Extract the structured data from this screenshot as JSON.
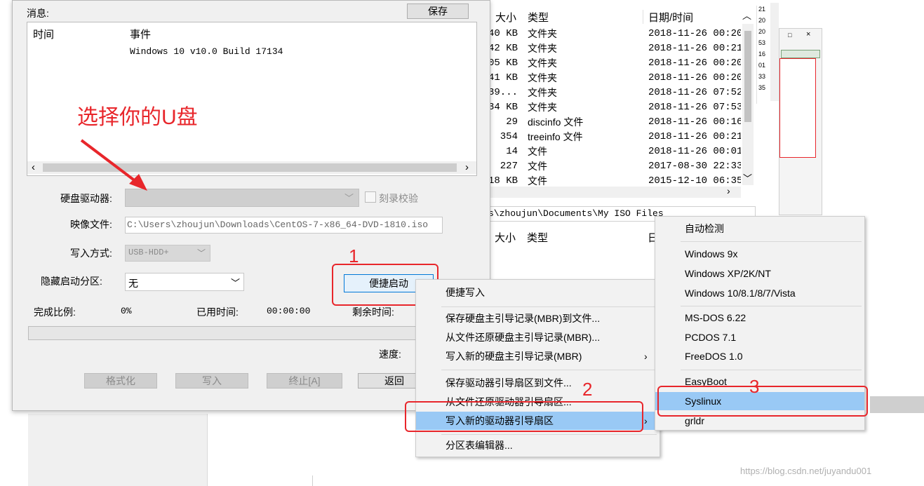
{
  "message_panel": {
    "title": "消息:",
    "save_button": "保存",
    "columns": [
      "时间",
      "事件"
    ],
    "rows": [
      {
        "time": "",
        "event": "Windows 10 v10.0 Build 17134"
      }
    ]
  },
  "annotation": {
    "text": "选择你的U盘",
    "n1": "1",
    "n2": "2",
    "n3": "3"
  },
  "form": {
    "drive_label": "硬盘驱动器:",
    "drive_value": "",
    "verify_label": "刻录校验",
    "image_label": "映像文件:",
    "image_value": "C:\\Users\\zhoujun\\Downloads\\CentOS-7-x86_64-DVD-1810.iso",
    "write_mode_label": "写入方式:",
    "write_mode_value": "USB-HDD+",
    "hide_label": "隐藏启动分区:",
    "hide_value": "无",
    "quick_boot_button": "便捷启动"
  },
  "progress": {
    "ratio_label": "完成比例:",
    "ratio_value": "0%",
    "elapsed_label": "已用时间:",
    "elapsed_value": "00:00:00",
    "remaining_label": "剩余时间:",
    "speed_label": "速度:",
    "fill": 0
  },
  "buttons": {
    "format": "格式化",
    "write": "写入",
    "stop": "终止[A]",
    "back": "返回"
  },
  "file_list_top": {
    "columns": [
      "大小",
      "类型",
      "日期/时间"
    ],
    "rows": [
      {
        "size": "40 KB",
        "type": "文件夹",
        "date": "2018-11-26 00:20"
      },
      {
        "size": "42 KB",
        "type": "文件夹",
        "date": "2018-11-26 00:21"
      },
      {
        "size": "05 KB",
        "type": "文件夹",
        "date": "2018-11-26 00:20"
      },
      {
        "size": "41 KB",
        "type": "文件夹",
        "date": "2018-11-26 00:20"
      },
      {
        "size": "39...",
        "type": "文件夹",
        "date": "2018-11-26 07:52"
      },
      {
        "size": "34 KB",
        "type": "文件夹",
        "date": "2018-11-26 07:53"
      },
      {
        "size": "29",
        "type": "discinfo 文件",
        "date": "2018-11-26 00:16"
      },
      {
        "size": "354",
        "type": "treeinfo 文件",
        "date": "2018-11-26 00:21"
      },
      {
        "size": "14",
        "type": "文件",
        "date": "2018-11-26 00:01"
      },
      {
        "size": "227",
        "type": "文件",
        "date": "2017-08-30 22:33"
      },
      {
        "size": "18 KB",
        "type": "文件",
        "date": "2015-12-10 06:35"
      }
    ],
    "side_numbers": [
      "21",
      "20",
      "20",
      "53",
      "16",
      "01",
      "33",
      "35"
    ]
  },
  "path_bar": "s\\zhoujun\\Documents\\My ISO Files",
  "file_list_bottom": {
    "columns": [
      "大小",
      "类型",
      "日"
    ]
  },
  "menu1": {
    "items": [
      "便捷写入",
      "保存硬盘主引导记录(MBR)到文件...",
      "从文件还原硬盘主引导记录(MBR)...",
      "写入新的硬盘主引导记录(MBR)",
      "保存驱动器引导扇区到文件...",
      "从文件还原驱动器引导扇区...",
      "写入新的驱动器引导扇区",
      "分区表编辑器..."
    ]
  },
  "menu2": {
    "items": [
      "自动检测",
      "Windows 9x",
      "Windows XP/2K/NT",
      "Windows 10/8.1/8/7/Vista",
      "MS-DOS 6.22",
      "PCDOS 7.1",
      "FreeDOS 1.0",
      "EasyBoot",
      "Syslinux",
      "grldr"
    ]
  },
  "watermark": "https://blog.csdn.net/juyandu001",
  "colors": {
    "highlight": "#99c9f5",
    "annotation_red": "#e8262b",
    "menu_bg": "#f2f2f2"
  }
}
